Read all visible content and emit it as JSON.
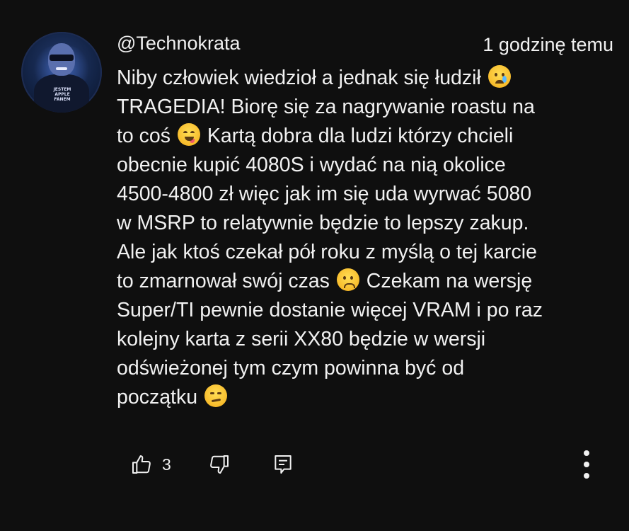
{
  "comment": {
    "author": "@Technokrata",
    "timestamp": "1 godzinę temu",
    "avatar_shirt_text": "JESTEM APPLE FANEM",
    "text_part1": "Niby człowiek wiedzioł a jednak się łudził ",
    "text_part2": "\nTRAGEDIA! Biorę się za nagrywanie roastu na\nto coś ",
    "text_part3": " Kartą dobra dla ludzi którzy chcieli\nobecnie kupić 4080S i wydać na nią okolice\n4500-4800 zł więc jak im się uda wyrwać 5080\nw MSRP to relatywnie będzie to lepszy zakup.\nAle jak ktoś czekał pół roku z myślą o tej karcie\nto zmarnował swój czas ",
    "text_part4": " Czekam na wersję\nSuper/TI pewnie dostanie więcej VRAM i po raz\nkolejny karta z serii XX80 będzie w wersji\nodświeżonej tym czym powinna być od\npoczątku ",
    "emojis": [
      "crying-face",
      "face-savoring-food",
      "slightly-frowning-face",
      "face-with-raised-eyebrow"
    ]
  },
  "actions": {
    "like_count": "3",
    "icons": [
      "thumbs-up-icon",
      "thumbs-down-icon",
      "reply-icon",
      "more-vert-icon"
    ]
  },
  "colors": {
    "background": "#0f0f0f",
    "text": "#f1f1f1"
  }
}
